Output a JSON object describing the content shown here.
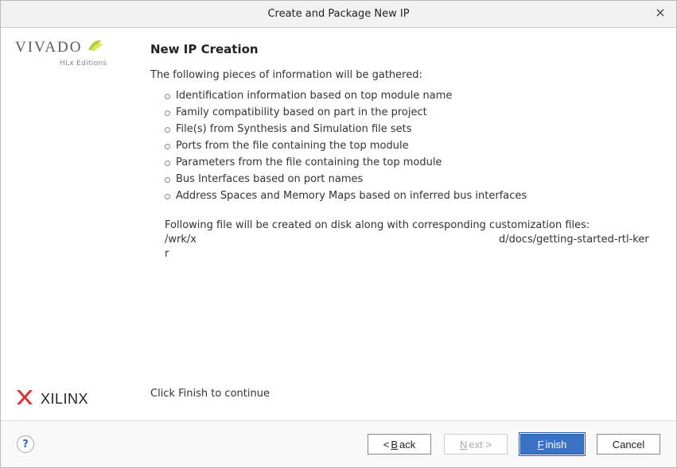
{
  "dialog": {
    "title": "Create and Package New IP"
  },
  "branding": {
    "vivado": "VIVADO",
    "hlx": "HLx Editions",
    "xilinx": "XILINX"
  },
  "page": {
    "heading": "New IP Creation",
    "intro": "The following pieces of information will be gathered:",
    "items": [
      "Identification information based on top module name",
      "Family compatibility based on part in the project",
      "File(s) from Synthesis and Simulation file sets",
      "Ports from the file containing the top module",
      "Parameters from the file containing the top module",
      "Bus Interfaces based on port names",
      "Address Spaces and Memory Maps based on inferred bus interfaces"
    ],
    "file_note_intro": "Following file will be created on disk along with corresponding customization files:",
    "file_path_prefix": "/wrk/x",
    "file_path_suffix": "d/docs/getting-started-rtl-kerr",
    "continue_text": "Click Finish to continue"
  },
  "buttons": {
    "help": "?",
    "back_prefix": "< ",
    "back_mnemonic": "B",
    "back_rest": "ack",
    "next_mnemonic": "N",
    "next_rest": "ext >",
    "finish_mnemonic": "F",
    "finish_rest": "inish",
    "cancel": "Cancel"
  }
}
